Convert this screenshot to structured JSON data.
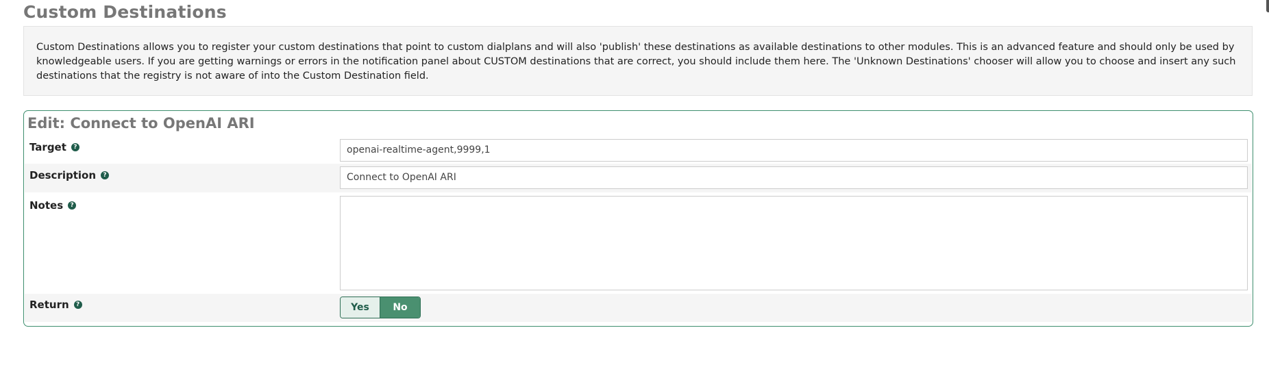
{
  "page": {
    "title": "Custom Destinations",
    "description": "Custom Destinations allows you to register your custom destinations that point to custom dialplans and will also 'publish' these destinations as available destinations to other modules. This is an advanced feature and should only be used by knowledgeable users. If you are getting warnings or errors in the notification panel about CUSTOM destinations that are correct, you should include them here. The 'Unknown Destinations' chooser will allow you to choose and insert any such destinations that the registry is not aware of into the Custom Destination field."
  },
  "form": {
    "title": "Edit: Connect to OpenAI ARI",
    "help_icon_glyph": "?",
    "target": {
      "label": "Target",
      "value": "openai-realtime-agent,9999,1"
    },
    "description": {
      "label": "Description",
      "value": "Connect to OpenAI ARI"
    },
    "notes": {
      "label": "Notes",
      "value": ""
    },
    "return": {
      "label": "Return",
      "options": [
        "Yes",
        "No"
      ],
      "selected": "No"
    }
  },
  "colors": {
    "panel_border": "#3e8e6e",
    "toggle_active": "#4a9070",
    "help_icon": "#1f5c4a"
  }
}
